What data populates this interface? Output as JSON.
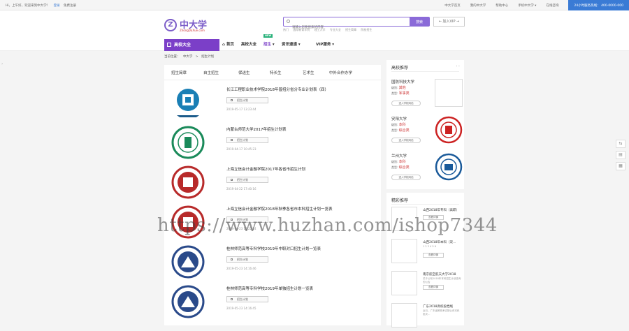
{
  "topbar": {
    "greeting": "Hi，上午好，欢迎来到中大学！",
    "login": "登录",
    "register": "免费注册",
    "links": [
      "中大学首页",
      "我的中大学",
      "帮助中心",
      "手机中大学 ▾",
      "在线咨询"
    ],
    "hotline": "24小时服务热线： 400-0000-000"
  },
  "header": {
    "logo_text": "中大学",
    "logo_sub": "ZhongDaXue.com",
    "logo_letter": "Z",
    "search_placeholder": "请输入您要搜索的内容",
    "search_button": "搜索",
    "hotwords": [
      "热门",
      "国际教育学院",
      "理工大学",
      "专业大全",
      "招生简章",
      "院校招生"
    ],
    "vip_button": "← 加入VIP →"
  },
  "nav": {
    "main": "高校大全",
    "items": [
      "首页",
      "高校大全",
      "招生",
      "资讯速递",
      "VIP服务"
    ],
    "badge": "NEW"
  },
  "breadcrumb": [
    "当前位置：",
    "中大学",
    ">",
    "招生计划"
  ],
  "tabs": [
    "招生简章",
    "自主招生",
    "保送生",
    "特长生",
    "艺术生",
    "中外合作办学"
  ],
  "list": [
    {
      "title": "长江工程职业技术学院2018年普招分省分专业计划表（四）",
      "button": "招生计划",
      "date": "2019-05-17 13:23:44"
    },
    {
      "title": "内蒙古师范大学2017年招生计划表",
      "button": "招生计划",
      "date": "2019-04-17 10:45:23"
    },
    {
      "title": "上海立信会计金融学院2017年各省市招生计划",
      "button": "招生计划",
      "date": "2019-04-22 17:40:16"
    },
    {
      "title": "上海立信会计金融学院2018年秋季各省市本科招生计划一览表",
      "button": "招生计划",
      "date": "2019-04-23 10:22:14"
    },
    {
      "title": "桂林师范高等专科学校2019年中职对口招生计划一览表",
      "button": "招生计划",
      "date": "2019-05-23 14:16:46"
    },
    {
      "title": "桂林师范高等专科学校2019年单独招生计划一览表",
      "button": "招生计划",
      "date": "2019-05-23 14:16:45"
    }
  ],
  "recommend": {
    "heading": "高校推荐",
    "arrows": "‹ ›",
    "view_button": "进入学校网站",
    "unis": [
      {
        "name": "国防科技大学",
        "k1": "级别",
        "v1": "其他",
        "k2": "类型",
        "v2": "军事类"
      },
      {
        "name": "安阳大学",
        "k1": "级别",
        "v1": "本科",
        "k2": "类型",
        "v2": "综合类"
      },
      {
        "name": "兰州大学",
        "k1": "级别",
        "v1": "本科",
        "k2": "类型",
        "v2": "综合类"
      }
    ]
  },
  "articles": {
    "heading": "精彩推荐",
    "items": [
      {
        "title": "山西2018年专科（高职）",
        "sub": "",
        "button": "查看详情"
      },
      {
        "title": "山西2018年本科（双…",
        "sub": "1 2 3 4 5 6",
        "button": "查看详情"
      },
      {
        "title": "南京航空航天大学2018",
        "sub": "关于公布2018年本科招生计划查询的公告",
        "button": "查看详情"
      },
      {
        "title": "广东2018高校投档线",
        "sub": "近日，广东省教育考试院公布本科批次…",
        "button": "查看详情"
      }
    ]
  },
  "sidetools": [
    "⇆",
    "▤",
    "▦"
  ],
  "watermark": "https://www.huzhan.com/ishop7344",
  "colors": {
    "brand": "#7b3fc8",
    "accent": "#3a7bd5",
    "red": "#c33",
    "badge": "#2ab27b"
  }
}
